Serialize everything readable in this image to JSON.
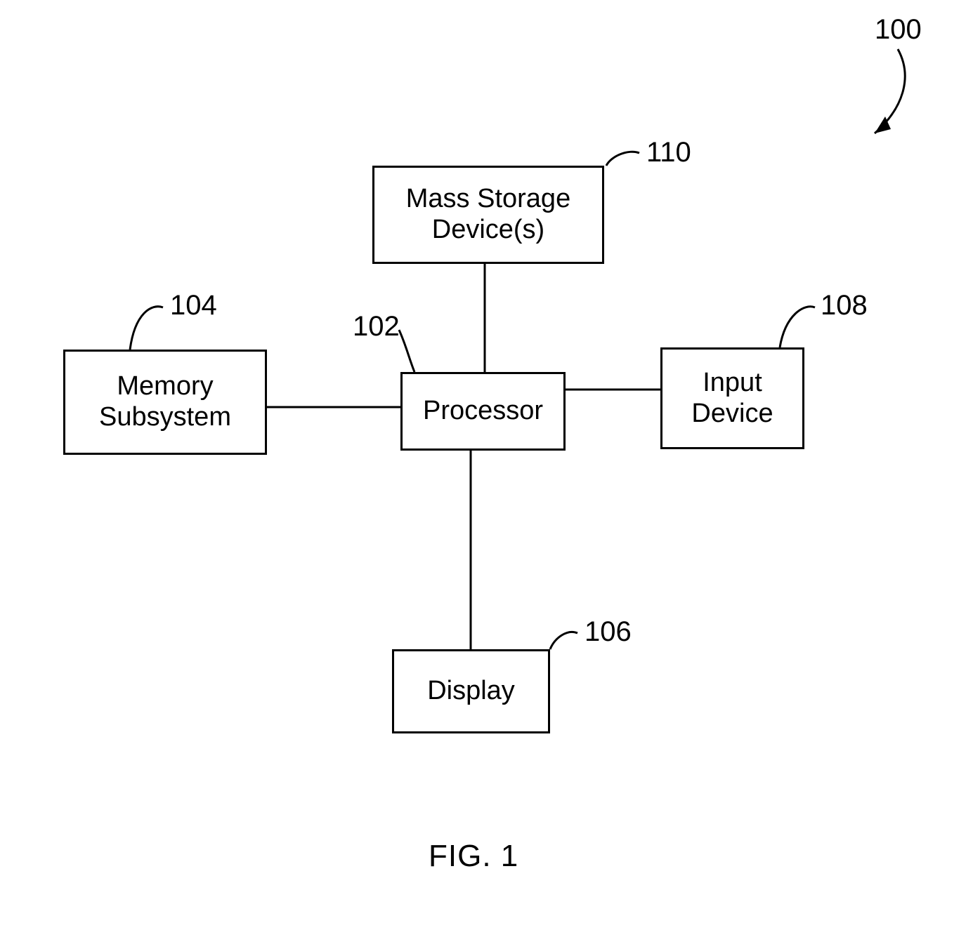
{
  "figure": {
    "ref_overall": "100",
    "caption": "FIG. 1"
  },
  "blocks": {
    "processor": {
      "label": "Processor",
      "ref": "102"
    },
    "memory": {
      "label": "Memory\nSubsystem",
      "ref": "104"
    },
    "display": {
      "label": "Display",
      "ref": "106"
    },
    "input": {
      "label": "Input\nDevice",
      "ref": "108"
    },
    "mass_storage": {
      "label": "Mass Storage\nDevice(s)",
      "ref": "110"
    }
  }
}
